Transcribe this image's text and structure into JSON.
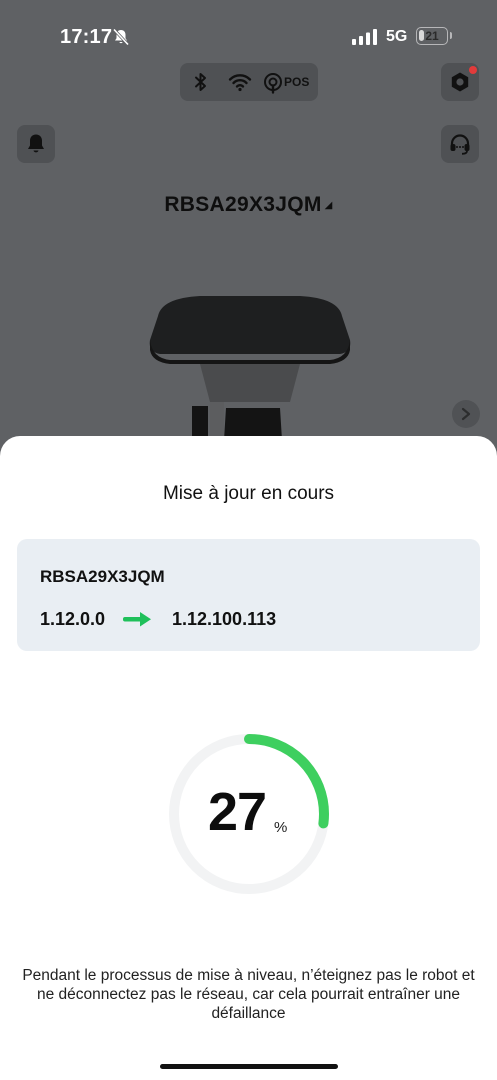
{
  "status_bar": {
    "time": "17:17",
    "network": "5G",
    "battery": "21",
    "battery_level": 0.21
  },
  "top_bar": {
    "connectivity": {
      "icons": [
        "bluetooth-icon",
        "wifi-icon",
        "pos-icon"
      ],
      "pos_label": "POS"
    },
    "settings_icon": "gear-icon",
    "notification_dot_color": "#e23b3b",
    "bell_icon": "bell-icon",
    "support_icon": "headset-icon"
  },
  "device": {
    "name": "RBSA29X3JQM",
    "caret": "◢"
  },
  "update_sheet": {
    "title": "Mise à jour en cours",
    "card": {
      "device_name": "RBSA29X3JQM",
      "current_version": "1.12.0.0",
      "new_version": "1.12.100.113"
    },
    "progress": {
      "value": "27",
      "unit": "%",
      "fraction": 0.27,
      "accent_color": "#3ecf5f",
      "track_color": "#f2f3f4"
    },
    "warning": "Pendant le processus de mise à niveau, n’éteignez pas le robot et ne déconnectez pas le réseau, car cela pourrait entraîner une défaillance"
  },
  "colors": {
    "accent_green": "#1fc05a",
    "card_background": "#e9eef3",
    "overlay": "#5f6164"
  }
}
